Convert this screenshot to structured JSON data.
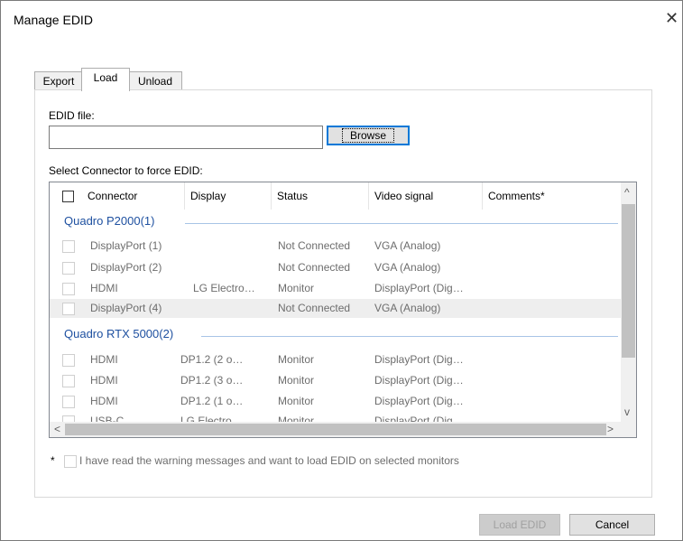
{
  "dialog": {
    "title": "Manage EDID",
    "close_glyph": "✕"
  },
  "tabs": [
    {
      "label": "Export",
      "active": false
    },
    {
      "label": "Load",
      "active": true
    },
    {
      "label": "Unload",
      "active": false
    }
  ],
  "edid_file": {
    "label": "EDID file:",
    "value": "",
    "browse_label": "Browse",
    "browse_mnemonic": "B"
  },
  "connector_section": {
    "label": "Select Connector to force EDID:"
  },
  "table": {
    "columns": [
      "Connector",
      "Display",
      "Status",
      "Video signal",
      "Comments*"
    ],
    "groups": [
      {
        "name": "Quadro P2000(1)",
        "rows": [
          {
            "connector": "DisplayPort (1)",
            "display": "",
            "status": "Not Connected",
            "video": "VGA (Analog)",
            "comments": ""
          },
          {
            "connector": "DisplayPort (2)",
            "display": "",
            "status": "Not Connected",
            "video": "VGA (Analog)",
            "comments": ""
          },
          {
            "connector": "HDMI",
            "display": "LG Electro…",
            "status": "Monitor",
            "video": "DisplayPort (Dig…",
            "comments": ""
          },
          {
            "connector": "DisplayPort (4)",
            "display": "",
            "status": "Not Connected",
            "video": "VGA (Analog)",
            "comments": ""
          }
        ]
      },
      {
        "name": "Quadro RTX 5000(2)",
        "rows": [
          {
            "connector": "HDMI",
            "display": "DP1.2 (2 o…",
            "status": "Monitor",
            "video": "DisplayPort (Dig…",
            "comments": ""
          },
          {
            "connector": "HDMI",
            "display": "DP1.2 (3 o…",
            "status": "Monitor",
            "video": "DisplayPort (Dig…",
            "comments": ""
          },
          {
            "connector": "HDMI",
            "display": "DP1.2 (1 o…",
            "status": "Monitor",
            "video": "DisplayPort (Dig…",
            "comments": ""
          },
          {
            "connector": "USB-C",
            "display": "LG Electro…",
            "status": "Monitor",
            "video": "DisplayPort (Dig…",
            "comments": ""
          }
        ]
      }
    ]
  },
  "scroll_arrows": {
    "up": "^",
    "down": "v",
    "left": "<",
    "right": ">"
  },
  "warning": {
    "star": "*",
    "text": "I have read the warning messages and want to load EDID on selected monitors",
    "mnemonic": "I"
  },
  "buttons": {
    "load_edid": "Load EDID",
    "cancel": "Cancel",
    "cancel_mnemonic": "C"
  },
  "colors": {
    "group_header": "#1e50a0",
    "focus_border": "#0078d7",
    "disabled_text": "#6d6d6d"
  }
}
